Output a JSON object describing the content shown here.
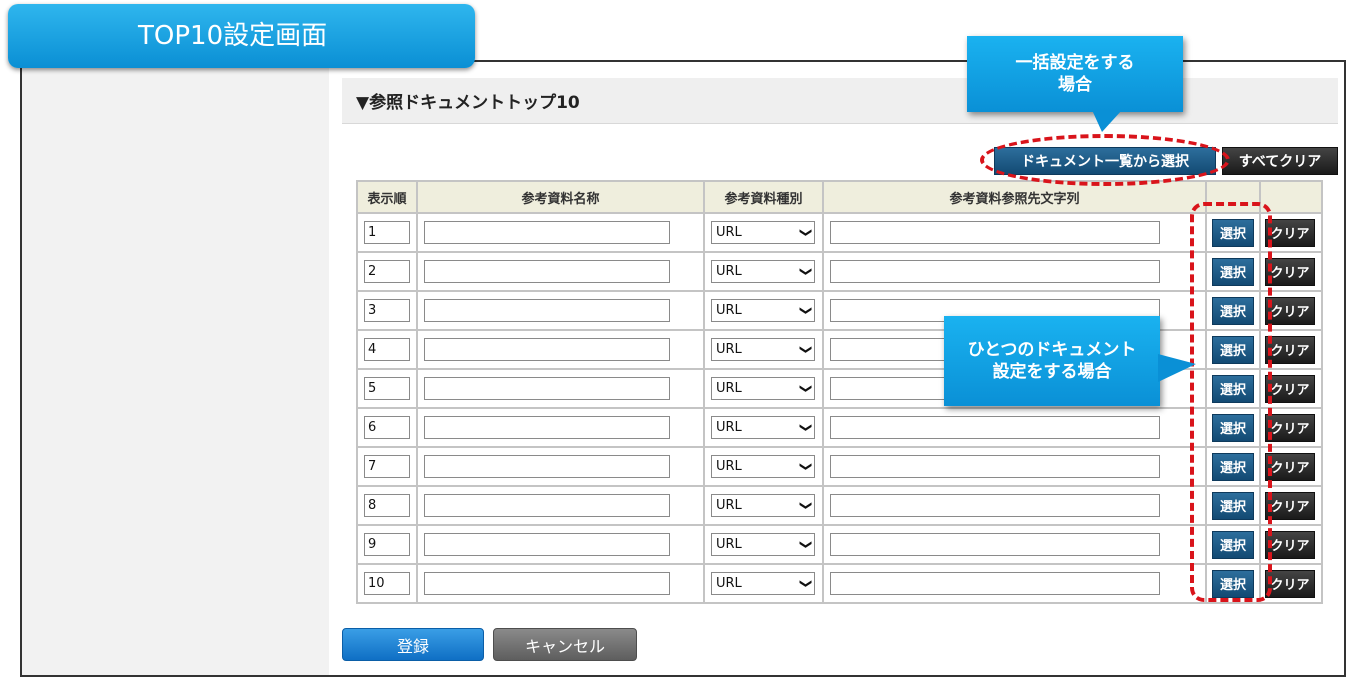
{
  "page_banner": "TOP10設定画面",
  "section_title": "▼参照ドキュメントトップ10",
  "toolbar": {
    "doc_list_button": "ドキュメント一覧から選択",
    "clear_all_button": "すべてクリア"
  },
  "table": {
    "headers": {
      "order": "表示順",
      "name": "参考資料名称",
      "type": "参考資料種別",
      "ref": "参考資料参照先文字列",
      "select": "",
      "clear": ""
    },
    "rows": [
      {
        "order": "1",
        "name": "",
        "type": "URL",
        "ref": ""
      },
      {
        "order": "2",
        "name": "",
        "type": "URL",
        "ref": ""
      },
      {
        "order": "3",
        "name": "",
        "type": "URL",
        "ref": ""
      },
      {
        "order": "4",
        "name": "",
        "type": "URL",
        "ref": ""
      },
      {
        "order": "5",
        "name": "",
        "type": "URL",
        "ref": ""
      },
      {
        "order": "6",
        "name": "",
        "type": "URL",
        "ref": ""
      },
      {
        "order": "7",
        "name": "",
        "type": "URL",
        "ref": ""
      },
      {
        "order": "8",
        "name": "",
        "type": "URL",
        "ref": ""
      },
      {
        "order": "9",
        "name": "",
        "type": "URL",
        "ref": ""
      },
      {
        "order": "10",
        "name": "",
        "type": "URL",
        "ref": ""
      }
    ],
    "select_label": "選択",
    "clear_label": "クリア"
  },
  "footer": {
    "register_button": "登録",
    "cancel_button": "キャンセル"
  },
  "callouts": {
    "bulk": "一括設定をする\n場合",
    "single": "ひとつのドキュメント\n設定をする場合"
  },
  "colors": {
    "banner": "#0a8fd4",
    "select_button": "#134a73",
    "clear_button": "#1a1a1a",
    "register_button": "#0f6fc4",
    "cancel_button": "#5e5e5e",
    "highlight_dash": "#d9141b",
    "header_bg": "#efeedd"
  }
}
